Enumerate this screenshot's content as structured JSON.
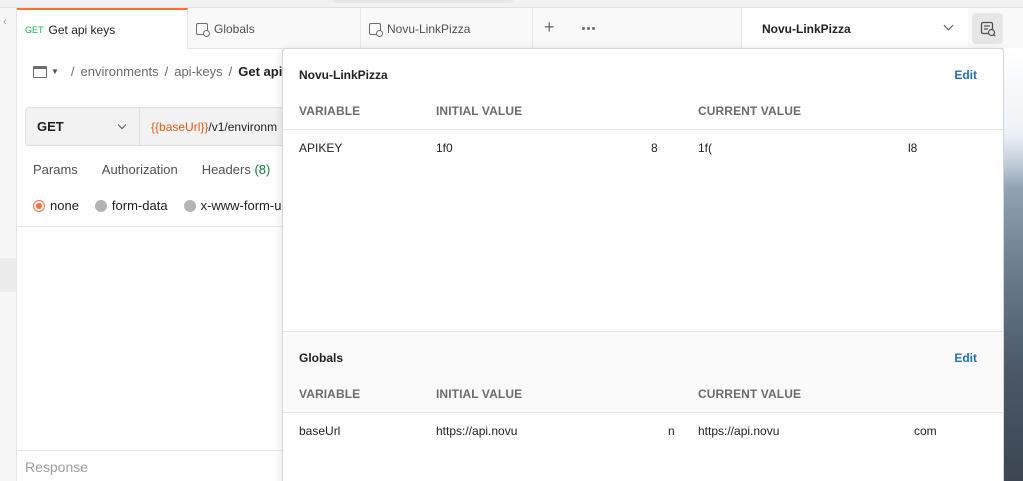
{
  "tabs": [
    {
      "method": "GET",
      "label": "Get api keys"
    },
    {
      "label": "Globals"
    },
    {
      "label": "Novu-LinkPizza"
    }
  ],
  "environment_selector": {
    "value": "Novu-LinkPizza"
  },
  "breadcrumb": {
    "items": [
      "environments",
      "api-keys"
    ],
    "separator": "/",
    "current": "Get api"
  },
  "request": {
    "method": "GET",
    "url_variable": "{{baseUrl}}",
    "url_rest": "/v1/environm"
  },
  "request_tabs": [
    {
      "label": "Params"
    },
    {
      "label": "Authorization"
    },
    {
      "label": "Headers",
      "count": "(8)"
    }
  ],
  "body_options": [
    {
      "label": "none",
      "selected": true
    },
    {
      "label": "form-data",
      "selected": false
    },
    {
      "label": "x-www-form-u",
      "selected": false
    }
  ],
  "response_label": "Response",
  "quicklook": {
    "environment": {
      "title": "Novu-LinkPizza",
      "edit_label": "Edit",
      "columns": [
        "VARIABLE",
        "INITIAL VALUE",
        "CURRENT VALUE"
      ],
      "rows": [
        {
          "variable": "APIKEY",
          "initial_start": "1f0",
          "initial_end": "8",
          "current_start": "1f(",
          "current_end": "l8"
        }
      ]
    },
    "globals": {
      "title": "Globals",
      "edit_label": "Edit",
      "columns": [
        "VARIABLE",
        "INITIAL VALUE",
        "CURRENT VALUE"
      ],
      "rows": [
        {
          "variable": "baseUrl",
          "initial_start": "https://api.novu",
          "initial_end": "n",
          "current_start": "https://api.novu",
          "current_end": "com"
        }
      ]
    }
  },
  "colors": {
    "accent": "#ff6c37",
    "link": "#1f6fbf",
    "get_method": "#0cbb52",
    "url_variable": "#e8590c"
  }
}
